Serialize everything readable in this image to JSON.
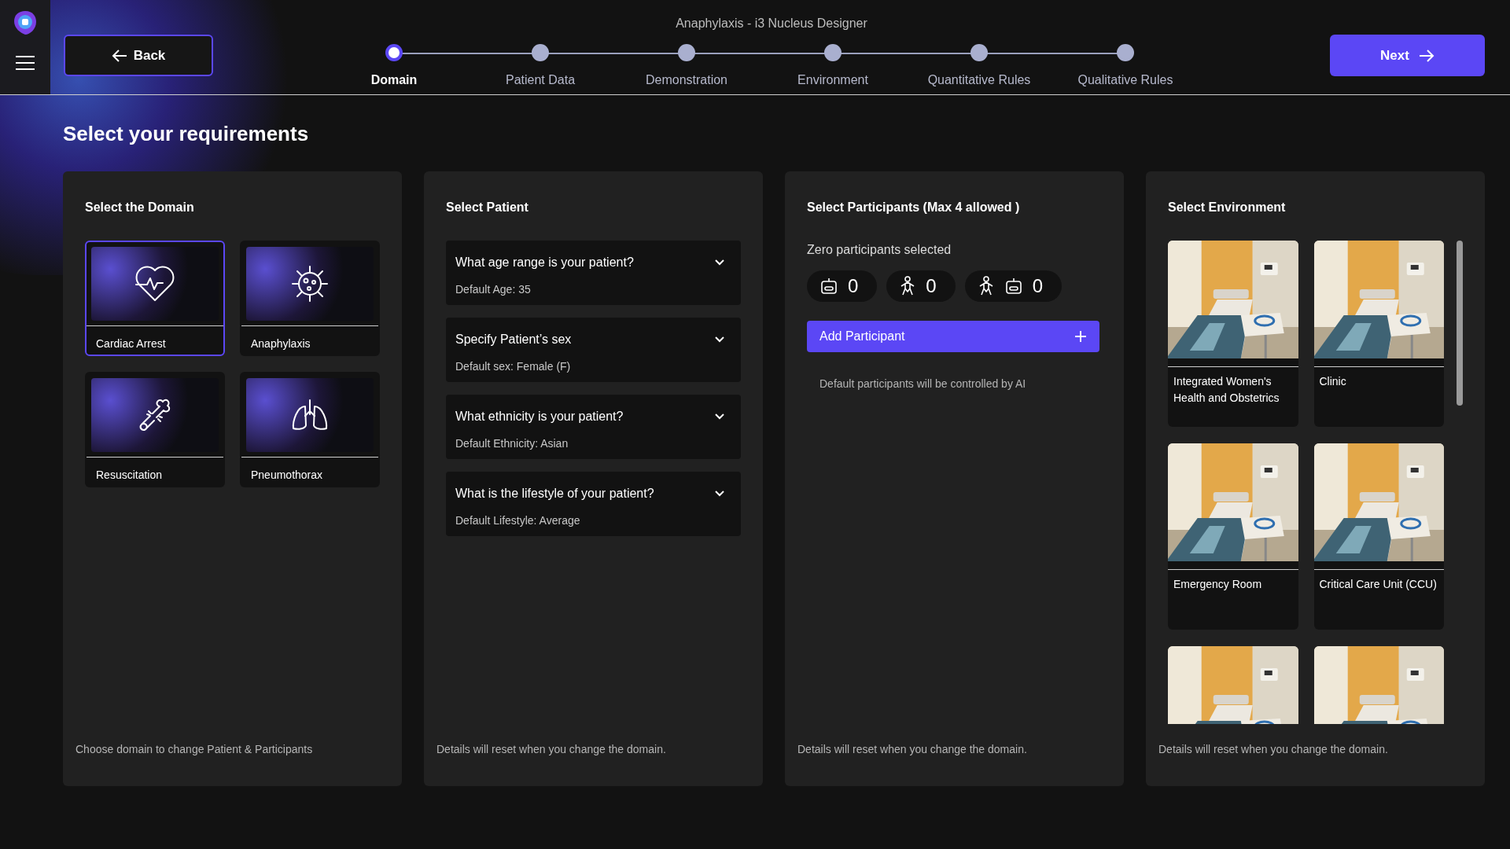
{
  "window": {
    "title": "Anaphylaxis - i3 Nucleus Designer"
  },
  "header": {
    "back": "Back",
    "next": "Next"
  },
  "steps": [
    {
      "label": "Domain",
      "selected": true
    },
    {
      "label": "Patient Data",
      "selected": false
    },
    {
      "label": "Demonstration",
      "selected": false
    },
    {
      "label": "Environment",
      "selected": false
    },
    {
      "label": "Quantitative Rules",
      "selected": false
    },
    {
      "label": "Qualitative Rules",
      "selected": false
    }
  ],
  "heading": "Select your requirements",
  "domain_panel": {
    "title": "Select the Domain",
    "footer": "Choose domain to change Patient & Participants",
    "domains": [
      {
        "name": "Cardiac Arrest",
        "selected": true
      },
      {
        "name": "Anaphylaxis",
        "selected": false
      },
      {
        "name": "Resuscitation",
        "selected": false
      },
      {
        "name": "Pneumothorax",
        "selected": false
      }
    ]
  },
  "patient_panel": {
    "title": "Select Patient",
    "footer": "Details will reset when you change the domain.",
    "questions": [
      {
        "question": "What age range is your patient?",
        "default": "Default Age: 35",
        "expanded": false
      },
      {
        "question": "Specify Patient’s sex",
        "default": "Default sex: Female (F)",
        "expanded": false
      },
      {
        "question": "What ethnicity is your patient?",
        "default": "Default Ethnicity: Asian",
        "expanded": false
      },
      {
        "question": "What is the lifestyle of your patient?",
        "default": "Default Lifestyle: Average",
        "expanded": false
      }
    ]
  },
  "participants_panel": {
    "title": "Select Participants (Max 4 allowed )",
    "status": "Zero participants selected",
    "counts": [
      {
        "kind": "ai",
        "count": "0"
      },
      {
        "kind": "human",
        "count": "0"
      },
      {
        "kind": "human_ai",
        "count": "0"
      }
    ],
    "add_button": "Add Participant",
    "note": "Default participants will be controlled by AI",
    "footer": "Details will reset when you change the domain."
  },
  "environment_panel": {
    "title": "Select Environment",
    "footer": "Details will reset when you change the domain.",
    "environments": [
      {
        "kind": "card",
        "name": "Integrated Women's Health and Obstetrics"
      },
      {
        "kind": "card",
        "name": "Clinic"
      },
      {
        "kind": "card",
        "name": "Emergency Room"
      },
      {
        "kind": "card",
        "name": "Critical Care Unit (CCU)"
      },
      {
        "kind": "picture"
      },
      {
        "kind": "picture"
      }
    ]
  }
}
